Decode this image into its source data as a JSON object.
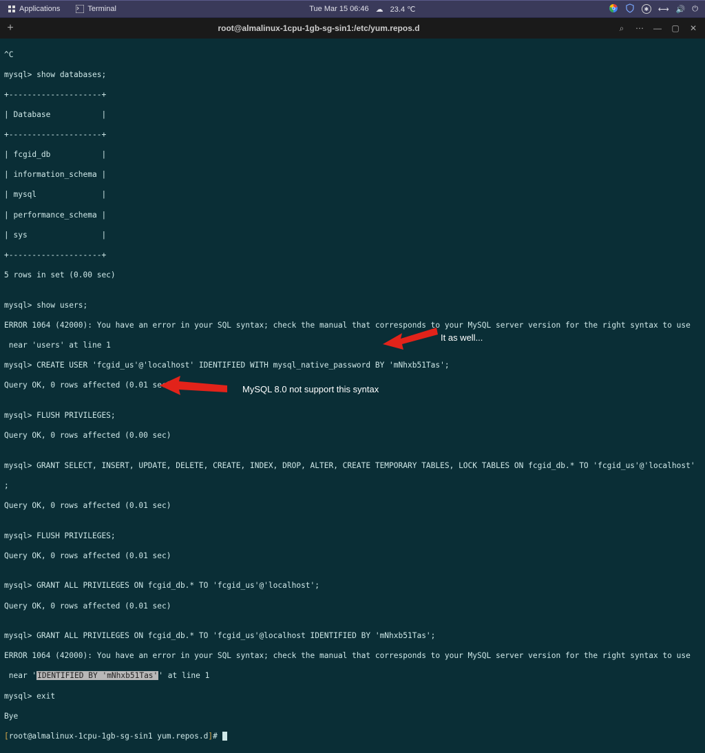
{
  "topbar": {
    "applications": "Applications",
    "terminal_app": "Terminal",
    "datetime": "Tue Mar 15  06:46",
    "temperature": "23.4 ℃"
  },
  "tabbar": {
    "title": "root@almalinux-1cpu-1gb-sg-sin1:/etc/yum.repos.d",
    "add": "+",
    "search": "⌕",
    "menu": "⋯",
    "minimize": "—",
    "maximize": "▢",
    "close": "✕"
  },
  "terminal": {
    "l1": "^C",
    "l2": "mysql> show databases;",
    "l3": "+--------------------+",
    "l4": "| Database           |",
    "l5": "+--------------------+",
    "l6": "| fcgid_db           |",
    "l7": "| information_schema |",
    "l8": "| mysql              |",
    "l9": "| performance_schema |",
    "l10": "| sys                |",
    "l11": "+--------------------+",
    "l12": "5 rows in set (0.00 sec)",
    "l13": "",
    "l14": "mysql> show users;",
    "l15": "ERROR 1064 (42000): You have an error in your SQL syntax; check the manual that corresponds to your MySQL server version for the right syntax to use",
    "l16": " near 'users' at line 1",
    "l17": "mysql> CREATE USER 'fcgid_us'@'localhost' IDENTIFIED WITH mysql_native_password BY 'mNhxb51Tas';",
    "l18": "Query OK, 0 rows affected (0.01 sec)",
    "l19": "",
    "l20": "mysql> FLUSH PRIVILEGES;",
    "l21": "Query OK, 0 rows affected (0.00 sec)",
    "l22": "",
    "l23": "mysql> GRANT SELECT, INSERT, UPDATE, DELETE, CREATE, INDEX, DROP, ALTER, CREATE TEMPORARY TABLES, LOCK TABLES ON fcgid_db.* TO 'fcgid_us'@'localhost'",
    "l24": ";",
    "l25": "Query OK, 0 rows affected (0.01 sec)",
    "l26": "",
    "l27": "mysql> FLUSH PRIVILEGES;",
    "l28": "Query OK, 0 rows affected (0.01 sec)",
    "l29": "",
    "l30": "mysql> GRANT ALL PRIVILEGES ON fcgid_db.* TO 'fcgid_us'@'localhost';",
    "l31": "Query OK, 0 rows affected (0.01 sec)",
    "l32": "",
    "l33": "mysql> GRANT ALL PRIVILEGES ON fcgid_db.* TO 'fcgid_us'@localhost IDENTIFIED BY 'mNhxb51Tas';",
    "l34": "ERROR 1064 (42000): You have an error in your SQL syntax; check the manual that corresponds to your MySQL server version for the right syntax to use",
    "l35a": " near '",
    "l35b": "IDENTIFIED BY 'mNhxb51Tas'",
    "l35c": "' at line 1",
    "l36": "mysql> exit",
    "l37": "Bye",
    "prompt_open": "[",
    "prompt_body": "root@almalinux-1cpu-1gb-sg-sin1 yum.repos.d",
    "prompt_close": "]",
    "prompt_hash": "# "
  },
  "annotations": {
    "a1": "It as well...",
    "a2": "MySQL 8.0 not support this syntax"
  }
}
